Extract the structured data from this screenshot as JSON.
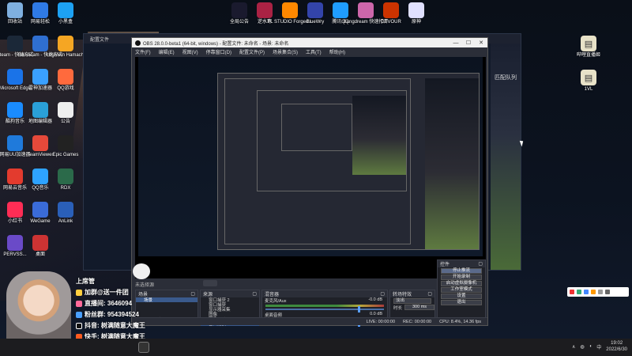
{
  "desktop_icons_left": [
    {
      "label": "回收站",
      "color": "#7fb0e0"
    },
    {
      "label": "网易轻松",
      "color": "#2f7ae5"
    },
    {
      "label": "小黑盒",
      "color": "#1da1f2"
    },
    {
      "label": "Steam - 快捷方式",
      "color": "#1b2838"
    },
    {
      "label": "Bandicam - 快捷方式",
      "color": "#2f6fd0"
    },
    {
      "label": "LogMeIn Hamachi",
      "color": "#f5a623"
    },
    {
      "label": "Microsoft Edge",
      "color": "#1a73e8"
    },
    {
      "label": "雷神加速器",
      "color": "#3aa0ff"
    },
    {
      "label": "QQ游戏",
      "color": "#ff6a3d"
    },
    {
      "label": "酷狗音乐",
      "color": "#1a8cff"
    },
    {
      "label": "地图编辑器",
      "color": "#2aa0d8"
    },
    {
      "label": "公告",
      "color": "#eeeeee"
    },
    {
      "label": "网易UU加速器",
      "color": "#1f7adb"
    },
    {
      "label": "TeamViewer",
      "color": "#e5493a"
    },
    {
      "label": "Epic Games",
      "color": "#222222"
    },
    {
      "label": "网易云音乐",
      "color": "#e33b2e"
    },
    {
      "label": "QQ音乐",
      "color": "#2ea3ff"
    },
    {
      "label": "RDX",
      "color": "#2b6a4a"
    },
    {
      "label": "小红书",
      "color": "#ff2d55"
    },
    {
      "label": "WeGame",
      "color": "#3a6bd8"
    },
    {
      "label": "AnLink",
      "color": "#2a5fb8"
    },
    {
      "label": "PERVSS...",
      "color": "#6a4ac8"
    },
    {
      "label": "桌面",
      "color": "#cc3333"
    }
  ],
  "desktop_icons_top": [
    {
      "label": "全局公告",
      "color": "#1a1a2e"
    },
    {
      "label": "逆水寒",
      "color": "#aa2244"
    },
    {
      "label": "FL STUDIO Forged...",
      "color": "#ff8800"
    },
    {
      "label": "BlueWry",
      "color": "#3344aa"
    },
    {
      "label": "腾讯QQ",
      "color": "#1f9dff"
    },
    {
      "label": "Bangdream 快速打开",
      "color": "#cc66aa"
    },
    {
      "label": "DEVOUR",
      "color": "#cc3300"
    },
    {
      "label": "原神",
      "color": "#e0e0ff"
    }
  ],
  "desktop_icons_right": [
    {
      "label": "哔哩直播姬"
    },
    {
      "label": "1VL"
    }
  ],
  "browser_window": {
    "title": "配置文件",
    "side_label": "匹配队列"
  },
  "obs": {
    "title": "OBS 28.0.0-beta1 (64-bit, windows) - 配置文件: 未命名 - 场景: 未命名",
    "menu": [
      "文件(F)",
      "编辑(E)",
      "视图(V)",
      "停靠窗口(D)",
      "配置文件(P)",
      "场景集合(S)",
      "工具(T)",
      "帮助(H)"
    ],
    "nav_label": "未选择源",
    "scenes": {
      "title": "场景",
      "items": [
        "场景"
      ]
    },
    "sources": {
      "title": "来源",
      "items": [
        "窗口捕获 2",
        "窗口捕获",
        "显示器采集",
        "图像",
        "图像 2",
        "窗口捕获 3"
      ]
    },
    "mixer": {
      "title": "混音器",
      "channels": [
        {
          "name": "麦克风/Aux",
          "db": "-0.0 dB"
        },
        {
          "name": "桌面音频",
          "db": "0.0 dB"
        }
      ]
    },
    "transitions": {
      "title": "转场特效",
      "type": "淡出",
      "duration_label": "时长",
      "duration": "300 ms"
    },
    "controls": {
      "title": "控件",
      "buttons": [
        "停止推流",
        "开始录制",
        "启动虚拟摄像机",
        "工作室模式",
        "设置",
        "退出"
      ]
    },
    "status": {
      "live": "LIVE: 00:00:00",
      "rec": "REC: 00:00:00",
      "cpu": "CPU: 8.4%, 14.36 fps"
    }
  },
  "overlay": {
    "name": "上席管",
    "lines": [
      "加群@送一件团",
      "直播间: 3646094",
      "粉丝群: 954394524",
      "抖音: 树满随意大魔王",
      "快手: 树满随意大魔王"
    ]
  },
  "taskbar": {
    "time": "19:02",
    "date": "2022/6/30"
  }
}
